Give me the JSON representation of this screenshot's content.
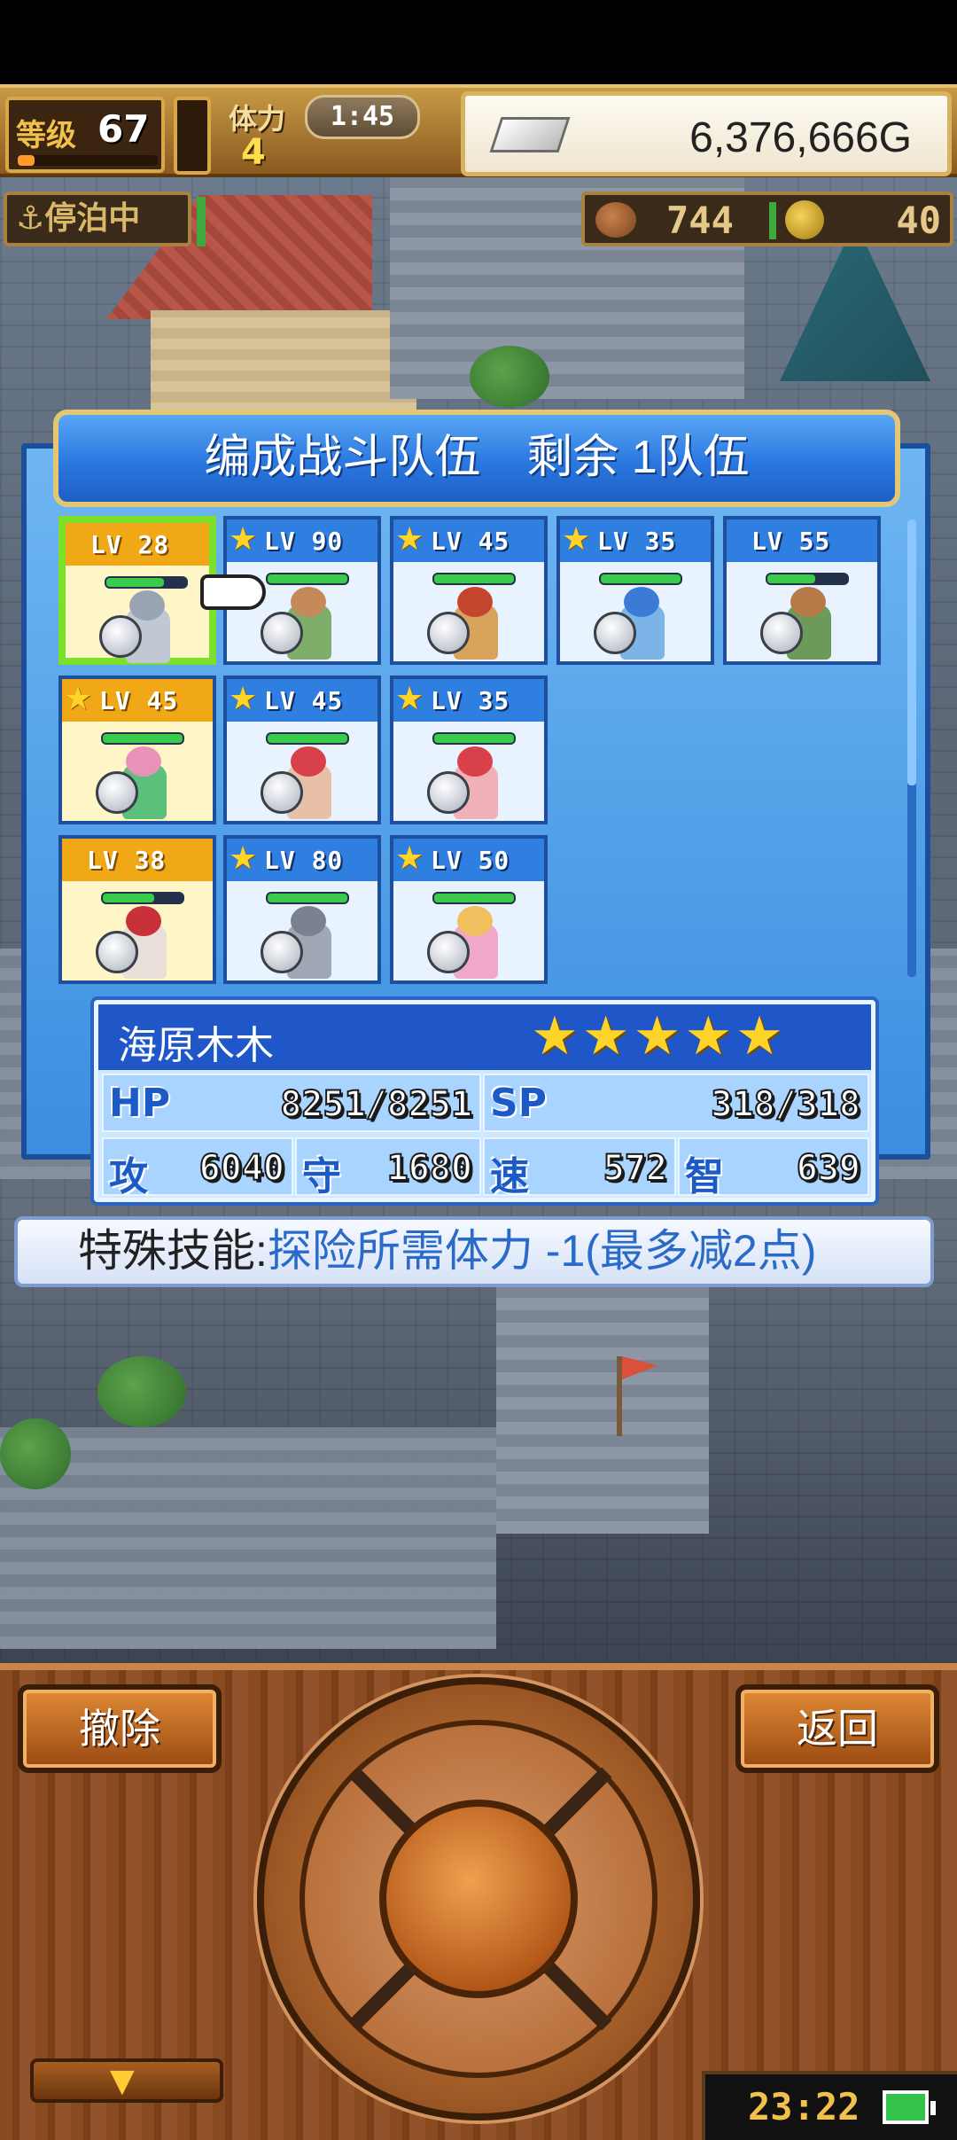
{
  "hud": {
    "level_label": "等级",
    "level": "67",
    "stamina_label": "体力",
    "stamina": "4",
    "timer": "1:45",
    "gold": "6,376,666G",
    "moor_status": "⚓停泊中",
    "meat": "744",
    "medals": "40",
    "level_progress": 0.12
  },
  "dialog": {
    "title": "编成战斗队伍　剩余 1队伍"
  },
  "party": [
    {
      "level": "LV 28",
      "star": false,
      "gold": true,
      "hp": 0.72,
      "selected": true,
      "head": "#9aa4b4",
      "body": "#c0c8d4"
    },
    {
      "level": "LV 90",
      "star": true,
      "gold": false,
      "hp": 1.0,
      "selected": false,
      "head": "#c58a5a",
      "body": "#7fae6a"
    },
    {
      "level": "LV 45",
      "star": true,
      "gold": false,
      "hp": 1.0,
      "selected": false,
      "head": "#c4452e",
      "body": "#d8a35a"
    },
    {
      "level": "LV 35",
      "star": true,
      "gold": false,
      "hp": 1.0,
      "selected": false,
      "head": "#3c7ad8",
      "body": "#7cb4e8"
    },
    {
      "level": "LV 55",
      "star": false,
      "gold": false,
      "hp": 0.6,
      "selected": false,
      "head": "#b57a48",
      "body": "#6b9a5a"
    },
    {
      "level": "LV 45",
      "star": true,
      "gold": true,
      "hp": 1.0,
      "selected": false,
      "head": "#e892b8",
      "body": "#5cc07a"
    },
    {
      "level": "LV 45",
      "star": true,
      "gold": false,
      "hp": 1.0,
      "selected": false,
      "head": "#d8404a",
      "body": "#e8c0a8"
    },
    {
      "level": "LV 35",
      "star": true,
      "gold": false,
      "hp": 1.0,
      "selected": false,
      "head": "#d8404a",
      "body": "#f0b0b8"
    },
    {
      "level": "LV 38",
      "star": false,
      "gold": true,
      "hp": 0.64,
      "selected": false,
      "head": "#c8303a",
      "body": "#e8e0d8"
    },
    {
      "level": "LV 80",
      "star": true,
      "gold": false,
      "hp": 1.0,
      "selected": false,
      "head": "#7a8292",
      "body": "#a0a8b6"
    },
    {
      "level": "LV 50",
      "star": true,
      "gold": false,
      "hp": 1.0,
      "selected": false,
      "head": "#f0c060",
      "body": "#f0a8c8"
    }
  ],
  "character": {
    "name": "海原木木",
    "stars": "★★★★★",
    "hp_label": "HP",
    "hp": "8251/8251",
    "sp_label": "SP",
    "sp": "318/318",
    "atk_label": "攻",
    "atk": "6040",
    "def_label": "守",
    "def": "1680",
    "spd_label": "速",
    "spd": "572",
    "int_label": "智",
    "int": "639"
  },
  "skill": {
    "label": "特殊技能:",
    "text": "探险所需体力 -1(最多减2点)"
  },
  "controls": {
    "remove_label": "撤除",
    "back_label": "返回",
    "down_arrow": "▼"
  },
  "status": {
    "clock": "23:22"
  },
  "colors": {
    "accent_blue": "#2a78e0",
    "gold_frame": "#e4c774",
    "select_green": "#7ce02a",
    "skill_text": "#2a6ac8"
  }
}
